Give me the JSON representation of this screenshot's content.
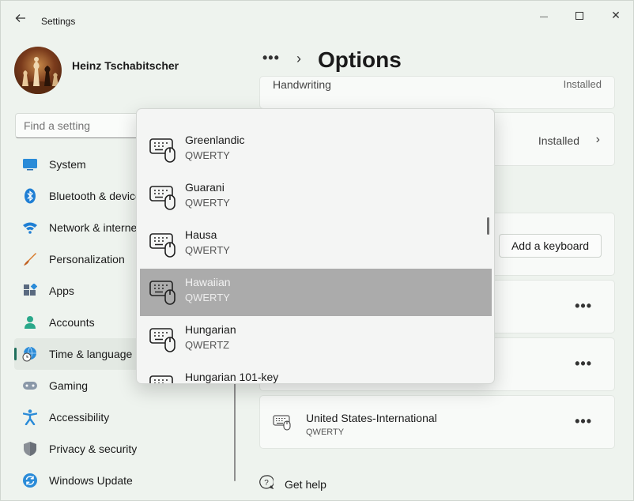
{
  "titlebar": {
    "title": "Settings",
    "back_icon": "back-arrow-icon",
    "minimize_glyph": "—",
    "close_glyph": "✕"
  },
  "profile": {
    "name": "Heinz Tschabitscher"
  },
  "search": {
    "placeholder": "Find a setting"
  },
  "nav": {
    "items": [
      {
        "label": "System",
        "icon": "system-icon",
        "selected": false
      },
      {
        "label": "Bluetooth & devices",
        "icon": "bluetooth-icon",
        "selected": false
      },
      {
        "label": "Network & internet",
        "icon": "wifi-icon",
        "selected": false
      },
      {
        "label": "Personalization",
        "icon": "brush-icon",
        "selected": false
      },
      {
        "label": "Apps",
        "icon": "apps-icon",
        "selected": false
      },
      {
        "label": "Accounts",
        "icon": "person-icon",
        "selected": false
      },
      {
        "label": "Time & language",
        "icon": "globe-clock-icon",
        "selected": true
      },
      {
        "label": "Gaming",
        "icon": "gamepad-icon",
        "selected": false
      },
      {
        "label": "Accessibility",
        "icon": "accessibility-icon",
        "selected": false
      },
      {
        "label": "Privacy & security",
        "icon": "shield-icon",
        "selected": false
      },
      {
        "label": "Windows Update",
        "icon": "update-icon",
        "selected": false
      }
    ]
  },
  "header": {
    "more_glyph": "•••",
    "chevron_glyph": "›",
    "title": "Options"
  },
  "cards": {
    "handwriting": {
      "label": "Handwriting",
      "status": "Installed"
    },
    "installed_row": {
      "status": "Installed",
      "chevron": "›"
    },
    "add_keyboard": {
      "button_label": "Add a keyboard"
    },
    "keyboard_more_glyph": "•••",
    "installed_keyboard": {
      "name": "United States-International",
      "layout": "QWERTY"
    }
  },
  "help": {
    "label": "Get help"
  },
  "popup": {
    "items": [
      {
        "name": "Greenlandic",
        "layout": "QWERTY",
        "selected": false
      },
      {
        "name": "Guarani",
        "layout": "QWERTY",
        "selected": false
      },
      {
        "name": "Hausa",
        "layout": "QWERTY",
        "selected": false
      },
      {
        "name": "Hawaiian",
        "layout": "QWERTY",
        "selected": true
      },
      {
        "name": "Hungarian",
        "layout": "QWERTZ",
        "selected": false
      },
      {
        "name": "Hungarian 101-key",
        "layout": "",
        "selected": false
      }
    ]
  },
  "colors": {
    "accent": "#1f6f5c",
    "window_bg": "#eef3ee",
    "selected_item": "#ababab"
  }
}
